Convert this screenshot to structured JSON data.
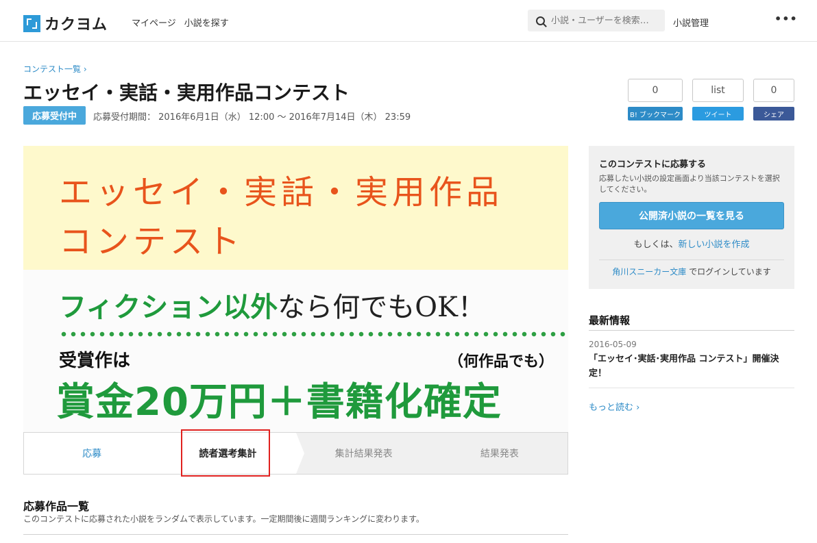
{
  "header": {
    "logo_text": "カクヨム",
    "nav": [
      "マイページ",
      "小説を探す"
    ],
    "search_placeholder": "小説・ユーザーを検索…",
    "manage_label": "小説管理",
    "more_label": "•••"
  },
  "contest": {
    "breadcrumb": "コンテスト一覧 ›",
    "title": "エッセイ・実話・実用作品コンテスト",
    "status": "応募受付中",
    "period": "応募受付期間： 2016年6月1日（水） 12:00 〜 2016年7月14日（木） 23:59"
  },
  "share": {
    "hatena": {
      "count": "0",
      "label": "B! ブックマーク",
      "color": "#2d8bc7"
    },
    "twitter": {
      "count": "list",
      "label": "ツイート",
      "color": "#2b9be0"
    },
    "facebook": {
      "count": "0",
      "label": "シェア",
      "color": "#3b5998"
    }
  },
  "banner": {
    "line1": "エッセイ・実話・実用作品",
    "line2": "コンテスト",
    "fiction_green": "フィクション以外",
    "fiction_rest": "なら何でもOK！",
    "award_label": "受賞作は",
    "award_note": "（何作品でも）",
    "award_main": "賞金20万円＋書籍化確定"
  },
  "steps": [
    "応募",
    "読者選考集計",
    "集計結果発表",
    "結果発表"
  ],
  "works": {
    "heading": "応募作品一覧",
    "description": "このコンテストに応募された小説をランダムで表示しています。一定期間後に週間ランキングに変わります。"
  },
  "apply": {
    "heading": "このコンテストに応募する",
    "description": "応募したい小説の設定画面より当該コンテストを選択してください。",
    "button": "公開済小説の一覧を見る",
    "or_prefix": "もしくは、",
    "or_link": "新しい小説を作成",
    "login_link": "角川スニーカー文庫",
    "login_suffix": "でログインしています"
  },
  "news": {
    "heading": "最新情報",
    "date": "2016-05-09",
    "text": "「エッセイ･実話･実用作品 コンテスト」開催決定！",
    "more": "もっと読む ›"
  }
}
